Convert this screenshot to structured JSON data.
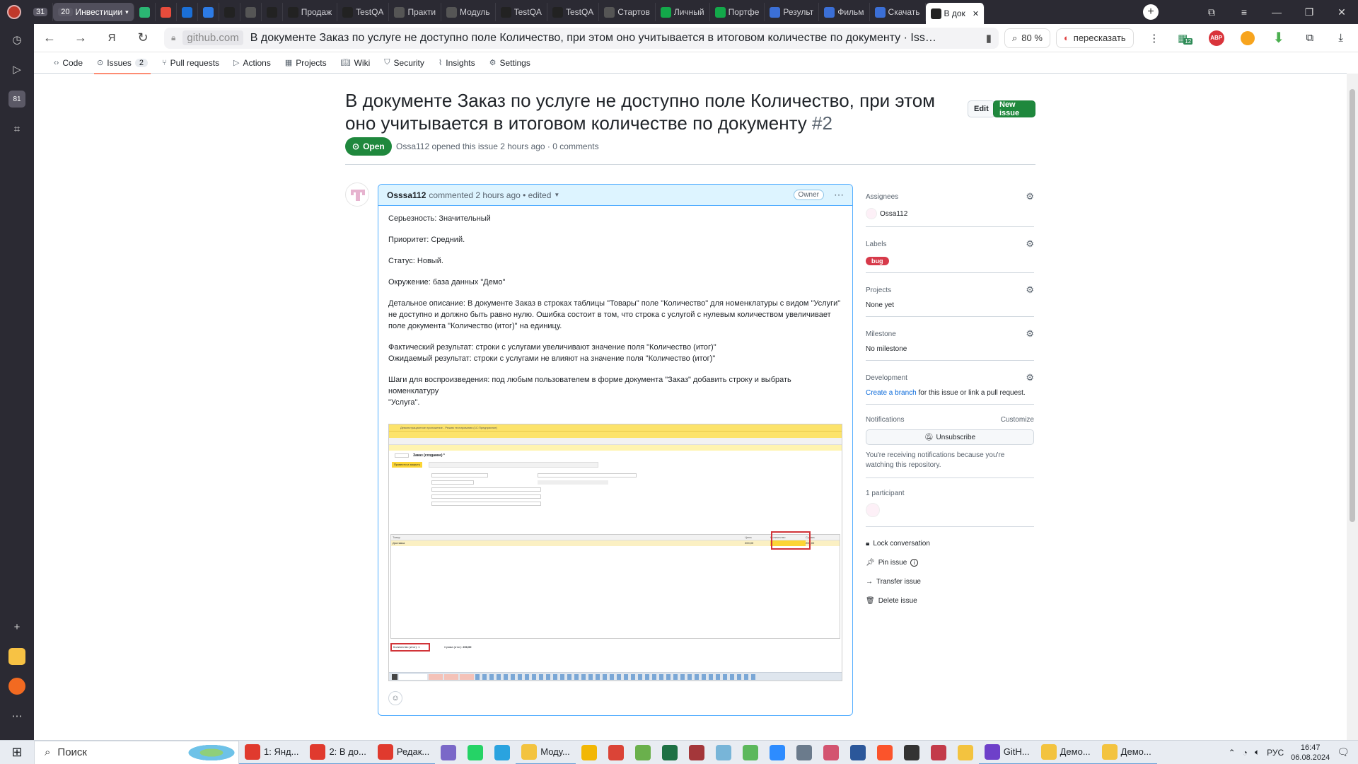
{
  "tabs": [
    {
      "label": "31",
      "icon": "counter-icon",
      "kind": "counter"
    },
    {
      "label": "Инвестиции",
      "count": "20",
      "kind": "group"
    },
    {
      "label": "",
      "icon": "shield-icon",
      "color": "#2bb673"
    },
    {
      "label": "",
      "icon": "red-square-icon",
      "color": "#e74c3c"
    },
    {
      "label": "",
      "icon": "iva-icon",
      "color": "#1b6fd6"
    },
    {
      "label": "",
      "icon": "mail-icon",
      "color": "#2d7be5"
    },
    {
      "label": "",
      "icon": "terminal-icon",
      "color": "#222"
    },
    {
      "label": "",
      "icon": "runner-icon",
      "color": "#555"
    },
    {
      "label": "",
      "icon": "github-icon",
      "color": "#222"
    },
    {
      "label": "Продаж",
      "icon": "github-icon",
      "color": "#222"
    },
    {
      "label": "TestQA",
      "icon": "github-icon",
      "color": "#222"
    },
    {
      "label": "Практи",
      "icon": "runner-icon",
      "color": "#555"
    },
    {
      "label": "Модуль",
      "icon": "runner-icon",
      "color": "#555"
    },
    {
      "label": "TestQA",
      "icon": "github-icon",
      "color": "#222"
    },
    {
      "label": "TestQA",
      "icon": "github-icon",
      "color": "#222"
    },
    {
      "label": "Стартов",
      "icon": "runner-icon",
      "color": "#555"
    },
    {
      "label": "Личный",
      "icon": "green-doc-icon",
      "color": "#13a84a"
    },
    {
      "label": "Портфе",
      "icon": "green-doc-icon",
      "color": "#13a84a"
    },
    {
      "label": "Результ",
      "icon": "globe-icon",
      "color": "#3b6fd6"
    },
    {
      "label": "Фильм",
      "icon": "globe-icon",
      "color": "#3b6fd6"
    },
    {
      "label": "Скачать",
      "icon": "globe-icon",
      "color": "#3b6fd6"
    },
    {
      "label": "В док",
      "icon": "github-icon",
      "color": "#222",
      "active": true
    }
  ],
  "address": {
    "domain": "github.com",
    "title": "В документе Заказ по услуге не доступно поле Количество, при этом оно учитывается в итоговом количестве по документу · Iss…",
    "zoom": "80 %",
    "retell": "пересказать",
    "ext_badge_count": "12"
  },
  "repo_nav": [
    {
      "label": "Code",
      "icon": "code-icon"
    },
    {
      "label": "Issues",
      "icon": "issue-icon",
      "count": "2",
      "selected": true
    },
    {
      "label": "Pull requests",
      "icon": "pull-request-icon"
    },
    {
      "label": "Actions",
      "icon": "play-icon"
    },
    {
      "label": "Projects",
      "icon": "table-icon"
    },
    {
      "label": "Wiki",
      "icon": "book-icon"
    },
    {
      "label": "Security",
      "icon": "shield-icon"
    },
    {
      "label": "Insights",
      "icon": "graph-icon"
    },
    {
      "label": "Settings",
      "icon": "gear-icon"
    }
  ],
  "issue": {
    "title": "В документе Заказ по услуге не доступно поле Количество, при этом оно учитывается в итоговом количестве по документу",
    "number": "#2",
    "state": "Open",
    "edit_label": "Edit",
    "new_issue_label": "New issue",
    "author": "Ossa112",
    "meta": "opened this issue 2 hours ago · 0 comments"
  },
  "comment": {
    "author": "Osssa112",
    "meta": "commented 2 hours ago • edited",
    "owner_badge": "Owner",
    "paragraphs": [
      "Серьезность: Значительный",
      "Приоритет: Средний.",
      "Статус: Новый.",
      "Окружение: база данных \"Демо\"",
      "Детальное описание: В документе Заказ в строках таблицы \"Товары\" поле \"Количество\" для номенклатуры с видом \"Услуги\" не доступно и должно быть равно нулю. Ошибка состоит в том, что строка с услугой с нулевым количеством увеличивает поле документа \"Количество (итог)\" на единицу.",
      "Фактический результат: строки с услугами увеличивают значение поля \"Количество (итог)\"",
      "Ожидаемый результат: строки с услугами не влияют на значение поля \"Количество (итог)\"",
      "Шаги для воспроизведения: под любым пользователем в форме документа \"Заказ\" добавить строку и выбрать номенклатуру",
      "\"Услуга\"."
    ],
    "shot": {
      "app_title": "Демонстрационное приложение - Режим тестирования (1С:Предприятие)",
      "doc_title": "Заказ (создание) *",
      "post_btn": "Провести и закрыть",
      "row_item": "Доставка",
      "row_price": "200,00",
      "row_sum": "200,00",
      "qty_total_label": "Количество (итог):",
      "qty_total_value": "1",
      "sum_total_label": "Сумма (итог):",
      "sum_total_value": "200,00",
      "col_goods": "Товар",
      "col_price": "Цена",
      "col_qty": "Количество",
      "col_sum": "Сумма"
    }
  },
  "sidebar": {
    "assignees_label": "Assignees",
    "assignee": "Ossa112",
    "labels_label": "Labels",
    "label_bug": "bug",
    "projects_label": "Projects",
    "projects_value": "None yet",
    "milestone_label": "Milestone",
    "milestone_value": "No milestone",
    "development_label": "Development",
    "dev_link": "Create a branch",
    "dev_rest": "for this issue or link a pull request.",
    "notifications_label": "Notifications",
    "customize": "Customize",
    "unsubscribe": "Unsubscribe",
    "notif_text": "You're receiving notifications because you're watching this repository.",
    "participants": "1 participant",
    "lock": "Lock conversation",
    "pin": "Pin issue",
    "transfer": "Transfer issue",
    "delete": "Delete issue"
  },
  "taskbar": {
    "search": "Поиск",
    "items": [
      {
        "label": "1: Янд...",
        "icon": "yandex-icon",
        "color": "#e03a2e"
      },
      {
        "label": "2: В до...",
        "icon": "yandex-icon",
        "color": "#e03a2e"
      },
      {
        "label": "Редак...",
        "icon": "yandex-icon",
        "color": "#e03a2e"
      },
      {
        "label": "",
        "icon": "pen-icon",
        "color": "#7a68c8"
      },
      {
        "label": "",
        "icon": "whatsapp-icon",
        "color": "#25d366"
      },
      {
        "label": "",
        "icon": "telegram-icon",
        "color": "#2aa3df"
      },
      {
        "label": "Моду...",
        "icon": "folder-icon",
        "color": "#f3c33f"
      },
      {
        "label": "",
        "icon": "chart-icon",
        "color": "#f2b705"
      },
      {
        "label": "",
        "icon": "chrome-icon",
        "color": "#db4437"
      },
      {
        "label": "",
        "icon": "notepad-icon",
        "color": "#6ab04c"
      },
      {
        "label": "",
        "icon": "excel-icon",
        "color": "#1d7044"
      },
      {
        "label": "",
        "icon": "access-icon",
        "color": "#a4373a"
      },
      {
        "label": "",
        "icon": "note-icon",
        "color": "#78b5d8"
      },
      {
        "label": "",
        "icon": "torrent-icon",
        "color": "#5cb85c"
      },
      {
        "label": "",
        "icon": "zoom-icon",
        "color": "#2d8cff"
      },
      {
        "label": "",
        "icon": "calculator-icon",
        "color": "#6b7b8c"
      },
      {
        "label": "",
        "icon": "scissors-icon",
        "color": "#d35470"
      },
      {
        "label": "",
        "icon": "word-icon",
        "color": "#2b579a"
      },
      {
        "label": "",
        "icon": "brave-icon",
        "color": "#fb542b"
      },
      {
        "label": "",
        "icon": "obs-icon",
        "color": "#333"
      },
      {
        "label": "",
        "icon": "p-icon",
        "color": "#c33b4a"
      },
      {
        "label": "",
        "icon": "onec-icon",
        "color": "#f3c33f"
      },
      {
        "label": "GitH...",
        "icon": "github-icon",
        "color": "#6e40c9"
      },
      {
        "label": "Демо...",
        "icon": "onec-icon",
        "color": "#f3c33f"
      },
      {
        "label": "Демо...",
        "icon": "onec-icon",
        "color": "#f3c33f"
      }
    ],
    "lang": "РУС",
    "time": "16:47",
    "date": "06.08.2024"
  }
}
